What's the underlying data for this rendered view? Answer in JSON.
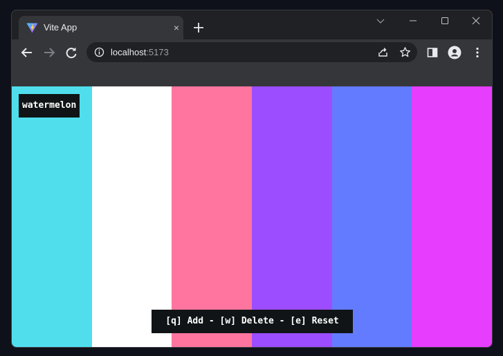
{
  "browser": {
    "tab": {
      "title": "Vite App",
      "favicon": "vite-logo-icon",
      "close": "×"
    },
    "new_tab": "plus-icon",
    "window_controls": [
      "chevron-down-icon",
      "minimize-icon",
      "maximize-icon",
      "close-icon"
    ],
    "address": {
      "host": "localhost",
      "port": ":5173"
    },
    "toolbar_icons": [
      "back-icon",
      "forward-icon",
      "reload-icon",
      "info-icon",
      "share-icon",
      "star-icon",
      "side-panel-icon",
      "profile-icon",
      "more-icon"
    ]
  },
  "app": {
    "selected_color_name": "watermelon",
    "stripes": [
      "#50deed",
      "#ffffff",
      "#ff759f",
      "#9c4dff",
      "#637bff",
      "#e63dff"
    ],
    "hint": "[q] Add - [w] Delete - [e] Reset"
  }
}
